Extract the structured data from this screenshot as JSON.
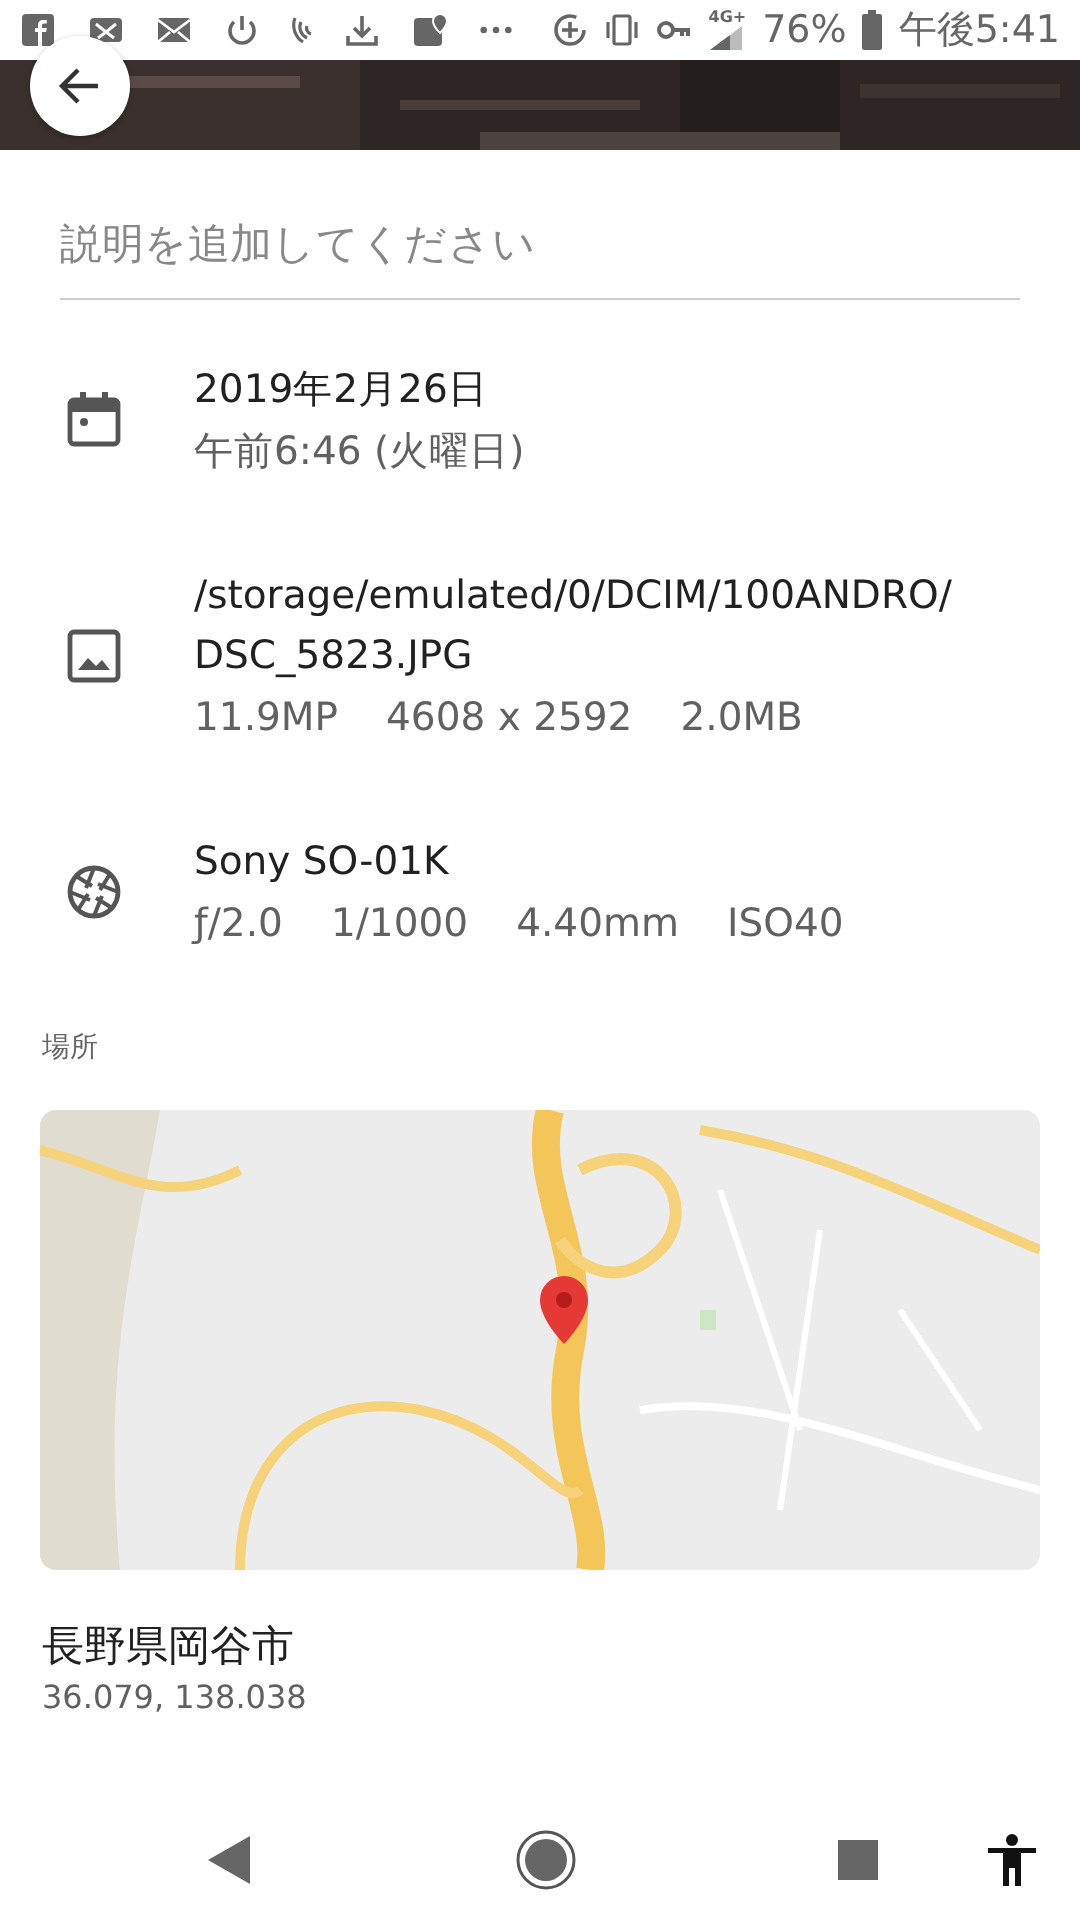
{
  "status_bar": {
    "network": "4G+",
    "battery": "76%",
    "time": "午後5:41"
  },
  "description": {
    "placeholder": "説明を追加してください"
  },
  "details": [
    {
      "kind": "date",
      "lines": [
        "2019年2月26日",
        "午前6:46 (火曜日)"
      ]
    },
    {
      "kind": "file",
      "lines": [
        "/storage/emulated/0/DCIM/100ANDRO/",
        "DSC_5823.JPG"
      ],
      "specs": [
        "11.9MP",
        "4608 x 2592",
        "2.0MB"
      ]
    },
    {
      "kind": "camera",
      "lines": [
        "Sony SO-01K"
      ],
      "specs": [
        "ƒ/2.0",
        "1/1000",
        "4.40mm",
        "ISO40"
      ]
    }
  ],
  "location": {
    "heading": "場所",
    "place": "長野県岡谷市",
    "coordinates": "36.079, 138.038"
  }
}
